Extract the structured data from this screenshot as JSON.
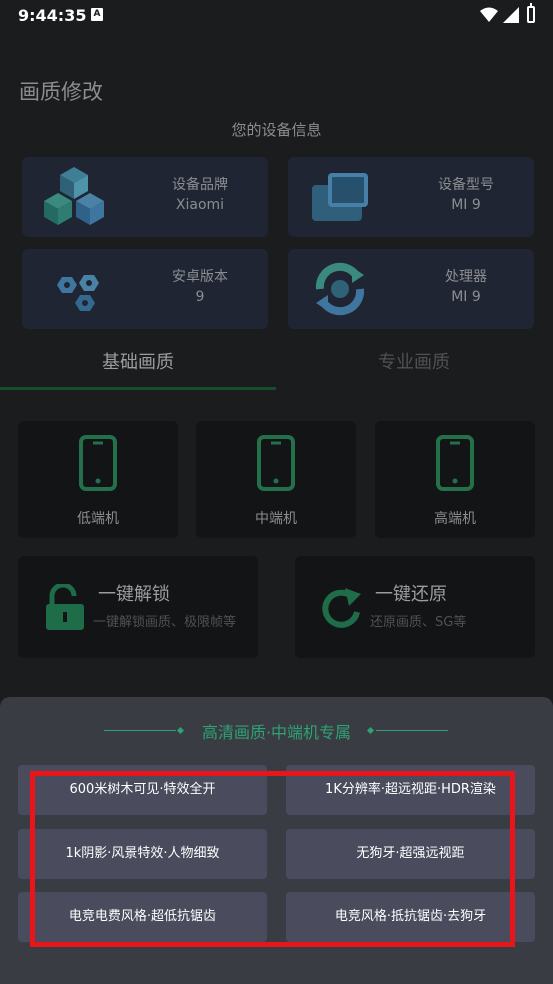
{
  "status_bar": {
    "time": "9:44:35",
    "badge": "A"
  },
  "page": {
    "title": "画质修改",
    "subtitle": "您的设备信息"
  },
  "device_info": [
    {
      "label": "设备品牌",
      "value": "Xiaomi",
      "icon": "cubes-icon"
    },
    {
      "label": "设备型号",
      "value": "MI 9",
      "icon": "devices-icon"
    },
    {
      "label": "安卓版本",
      "value": "9",
      "icon": "nuts-icon"
    },
    {
      "label": "处理器",
      "value": "MI 9",
      "icon": "processor-cycle-icon"
    }
  ],
  "tabs": [
    {
      "label": "基础画质",
      "active": true
    },
    {
      "label": "专业画质",
      "active": false
    }
  ],
  "tiers": [
    {
      "label": "低端机",
      "icon": "phone-icon"
    },
    {
      "label": "中端机",
      "icon": "phone-icon"
    },
    {
      "label": "高端机",
      "icon": "phone-icon"
    }
  ],
  "actions": [
    {
      "title": "一键解锁",
      "desc": "一键解锁画质、极限帧等",
      "icon": "unlock-icon"
    },
    {
      "title": "一键还原",
      "desc": "还原画质、SG等",
      "icon": "refresh-icon"
    }
  ],
  "sheet": {
    "title": "高清画质·中端机专属",
    "options": [
      "600米树木可见·特效全开",
      "1K分辨率·超远视距·HDR渲染",
      "1k阴影·风景特效·人物细致",
      "无狗牙·超强远视距",
      "电竞电费风格·超低抗锯齿",
      "电竞风格·抵抗锯齿·去狗牙"
    ]
  },
  "colors": {
    "accent": "#2ea272",
    "sheet_bg": "#3a3c44",
    "option_bg": "#4a4c5e",
    "highlight": "#e8161a"
  }
}
